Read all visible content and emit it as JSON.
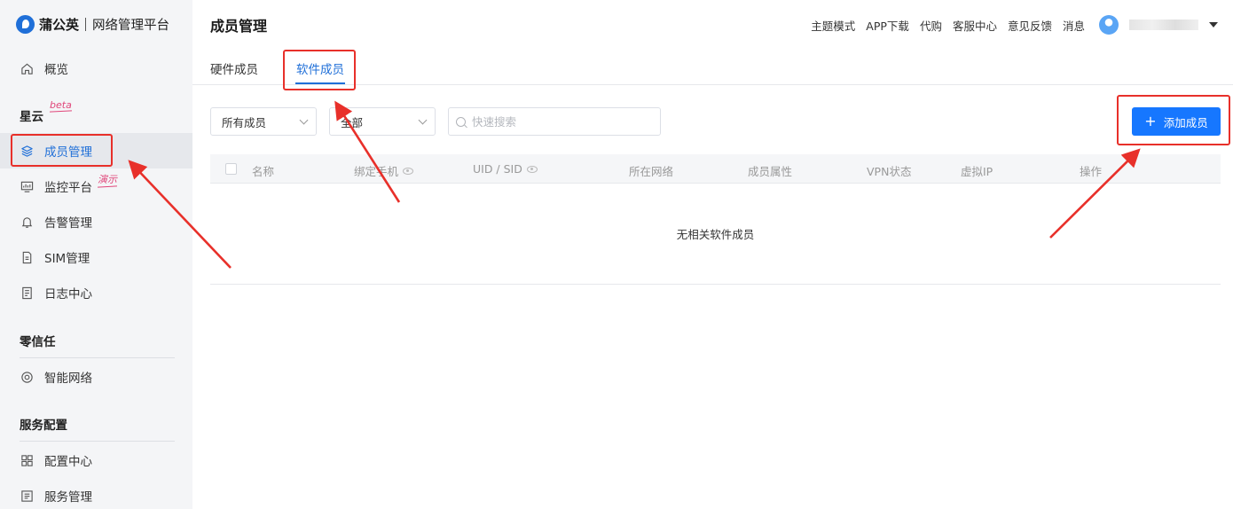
{
  "app": {
    "brand": "蒲公英",
    "subtitle": "网络管理平台"
  },
  "sidebar": {
    "overview": "概览",
    "sections": [
      {
        "title": "星云",
        "tag": "beta"
      },
      {
        "title": "零信任"
      },
      {
        "title": "服务配置"
      }
    ],
    "items": [
      {
        "label": "成员管理",
        "icon": "layers-icon",
        "active": true
      },
      {
        "label": "监控平台",
        "icon": "monitor-icon",
        "tag": "演示"
      },
      {
        "label": "告警管理",
        "icon": "bell-icon"
      },
      {
        "label": "SIM管理",
        "icon": "sim-card-icon"
      },
      {
        "label": "日志中心",
        "icon": "log-icon"
      },
      {
        "label": "智能网络",
        "icon": "network-icon"
      },
      {
        "label": "配置中心",
        "icon": "grid-icon"
      },
      {
        "label": "服务管理",
        "icon": "list-icon"
      }
    ]
  },
  "header": {
    "page_title": "成员管理",
    "links": [
      "主题模式",
      "APP下载",
      "代购",
      "客服中心",
      "意见反馈",
      "消息"
    ]
  },
  "tabs": [
    "硬件成员",
    "软件成员"
  ],
  "active_tab": 1,
  "filters": {
    "member_select": "所有成员",
    "scope_select": "全部",
    "search_placeholder": "快速搜索"
  },
  "add_button": "添加成员",
  "table": {
    "columns": [
      "名称",
      "绑定手机",
      "UID / SID",
      "所在网络",
      "成员属性",
      "VPN状态",
      "虚拟IP",
      "操作"
    ],
    "empty_text": "无相关软件成员"
  },
  "colors": {
    "primary": "#1677ff",
    "annotation": "#e8302a"
  }
}
